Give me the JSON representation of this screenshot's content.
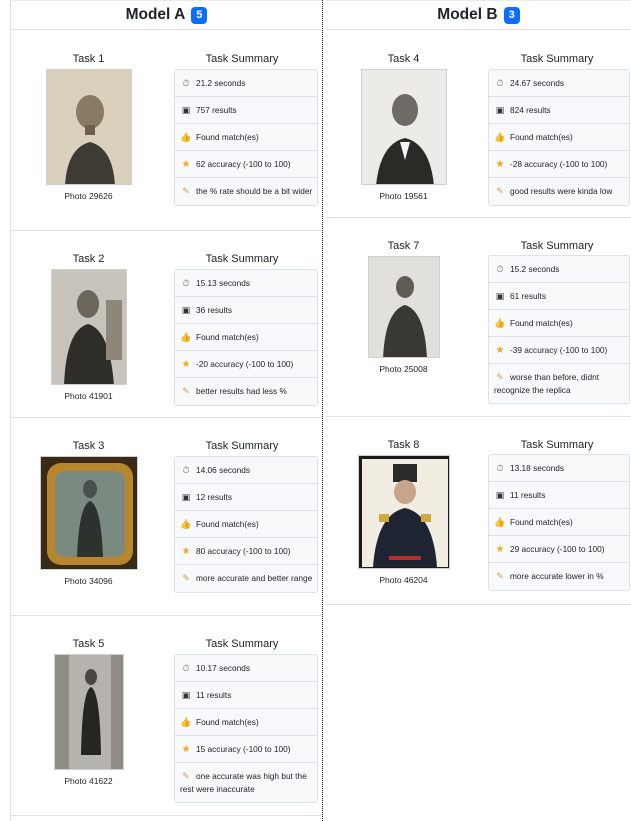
{
  "modelA": {
    "title": "Model A",
    "badge": "5"
  },
  "modelB": {
    "title": "Model B",
    "badge": "3"
  },
  "summaryTitle": "Task Summary",
  "tasksA": [
    {
      "task": "Task 1",
      "photo": "Photo 29626",
      "time": "21.2 seconds",
      "results": "757 results",
      "match": "Found match(es)",
      "accuracy": "62 accuracy (-100 to 100)",
      "note": "the % rate should be a bit wider"
    },
    {
      "task": "Task 2",
      "photo": "Photo 41901",
      "time": "15.13 seconds",
      "results": "36 results",
      "match": "Found match(es)",
      "accuracy": "-20 accuracy (-100 to 100)",
      "note": "better results had less %"
    },
    {
      "task": "Task 3",
      "photo": "Photo 34096",
      "time": "14.06 seconds",
      "results": "12 results",
      "match": "Found match(es)",
      "accuracy": "80 accuracy (-100 to 100)",
      "note": "more accurate and better range"
    },
    {
      "task": "Task 5",
      "photo": "Photo 41622",
      "time": "10.17 seconds",
      "results": "11 results",
      "match": "Found match(es)",
      "accuracy": "15 accuracy (-100 to 100)",
      "note": "one accurate was high but the rest were inaccurate"
    }
  ],
  "tasksB": [
    {
      "task": "Task 4",
      "photo": "Photo 19561",
      "time": "24.67 seconds",
      "results": "824 results",
      "match": "Found match(es)",
      "accuracy": "-28 accuracy (-100 to 100)",
      "note": "good results were kinda low"
    },
    {
      "task": "Task 7",
      "photo": "Photo 25008",
      "time": "15.2 seconds",
      "results": "61 results",
      "match": "Found match(es)",
      "accuracy": "-39 accuracy (-100 to 100)",
      "note": "worse than before, didnt recognize the replica"
    },
    {
      "task": "Task 8",
      "photo": "Photo 46204",
      "time": "13.18 seconds",
      "results": "11 results",
      "match": "Found match(es)",
      "accuracy": "29 accuracy (-100 to 100)",
      "note": "more accurate lower in %"
    }
  ],
  "icons": {
    "time": "stopwatch-icon",
    "results": "photos-icon",
    "match": "thumbs-up-icon",
    "accuracy": "star-icon",
    "note": "memo-icon"
  },
  "colors": {
    "badge": "#0d6efd",
    "star": "#f5a623"
  }
}
